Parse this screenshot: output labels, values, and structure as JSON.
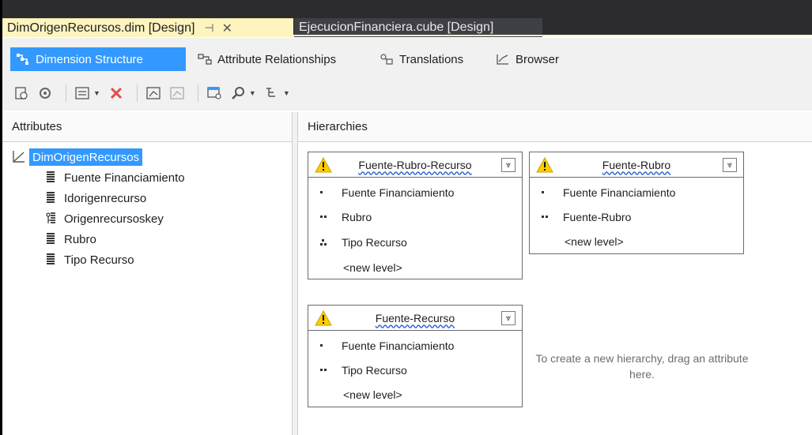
{
  "doc_tabs": {
    "active_label": "DimOrigenRecursos.dim [Design]",
    "pin_glyph": "⊣",
    "close_glyph": "✕",
    "inactive_label": "EjecucionFinanciera.cube [Design]"
  },
  "designer_tabs": [
    {
      "label": "Dimension Structure"
    },
    {
      "label": "Attribute Relationships"
    },
    {
      "label": "Translations"
    },
    {
      "label": "Browser"
    }
  ],
  "attributes_pane": {
    "header": "Attributes",
    "root": "DimOrigenRecursos",
    "items": [
      "Fuente Financiamiento",
      "Idorigenrecurso",
      "Origenrecursoskey",
      "Rubro",
      "Tipo Recurso"
    ]
  },
  "hierarchies_pane": {
    "header": "Hierarchies",
    "hint": "To create a new hierarchy, drag an attribute here.",
    "new_level": "<new level>",
    "cards": [
      {
        "title": "Fuente-Rubro-Recurso",
        "levels": [
          "Fuente Financiamiento",
          "Rubro",
          "Tipo Recurso"
        ]
      },
      {
        "title": "Fuente-Rubro",
        "levels": [
          "Fuente Financiamiento",
          "Fuente-Rubro"
        ]
      },
      {
        "title": "Fuente-Recurso",
        "levels": [
          "Fuente Financiamiento",
          "Tipo Recurso"
        ]
      }
    ]
  },
  "colors": {
    "accent": "#3399ff",
    "active_tab_bg": "#fdf4bf",
    "dark_chrome": "#2b2b30",
    "inactive_tab_bg": "#3f3f46",
    "warning": "#ffcc00"
  }
}
